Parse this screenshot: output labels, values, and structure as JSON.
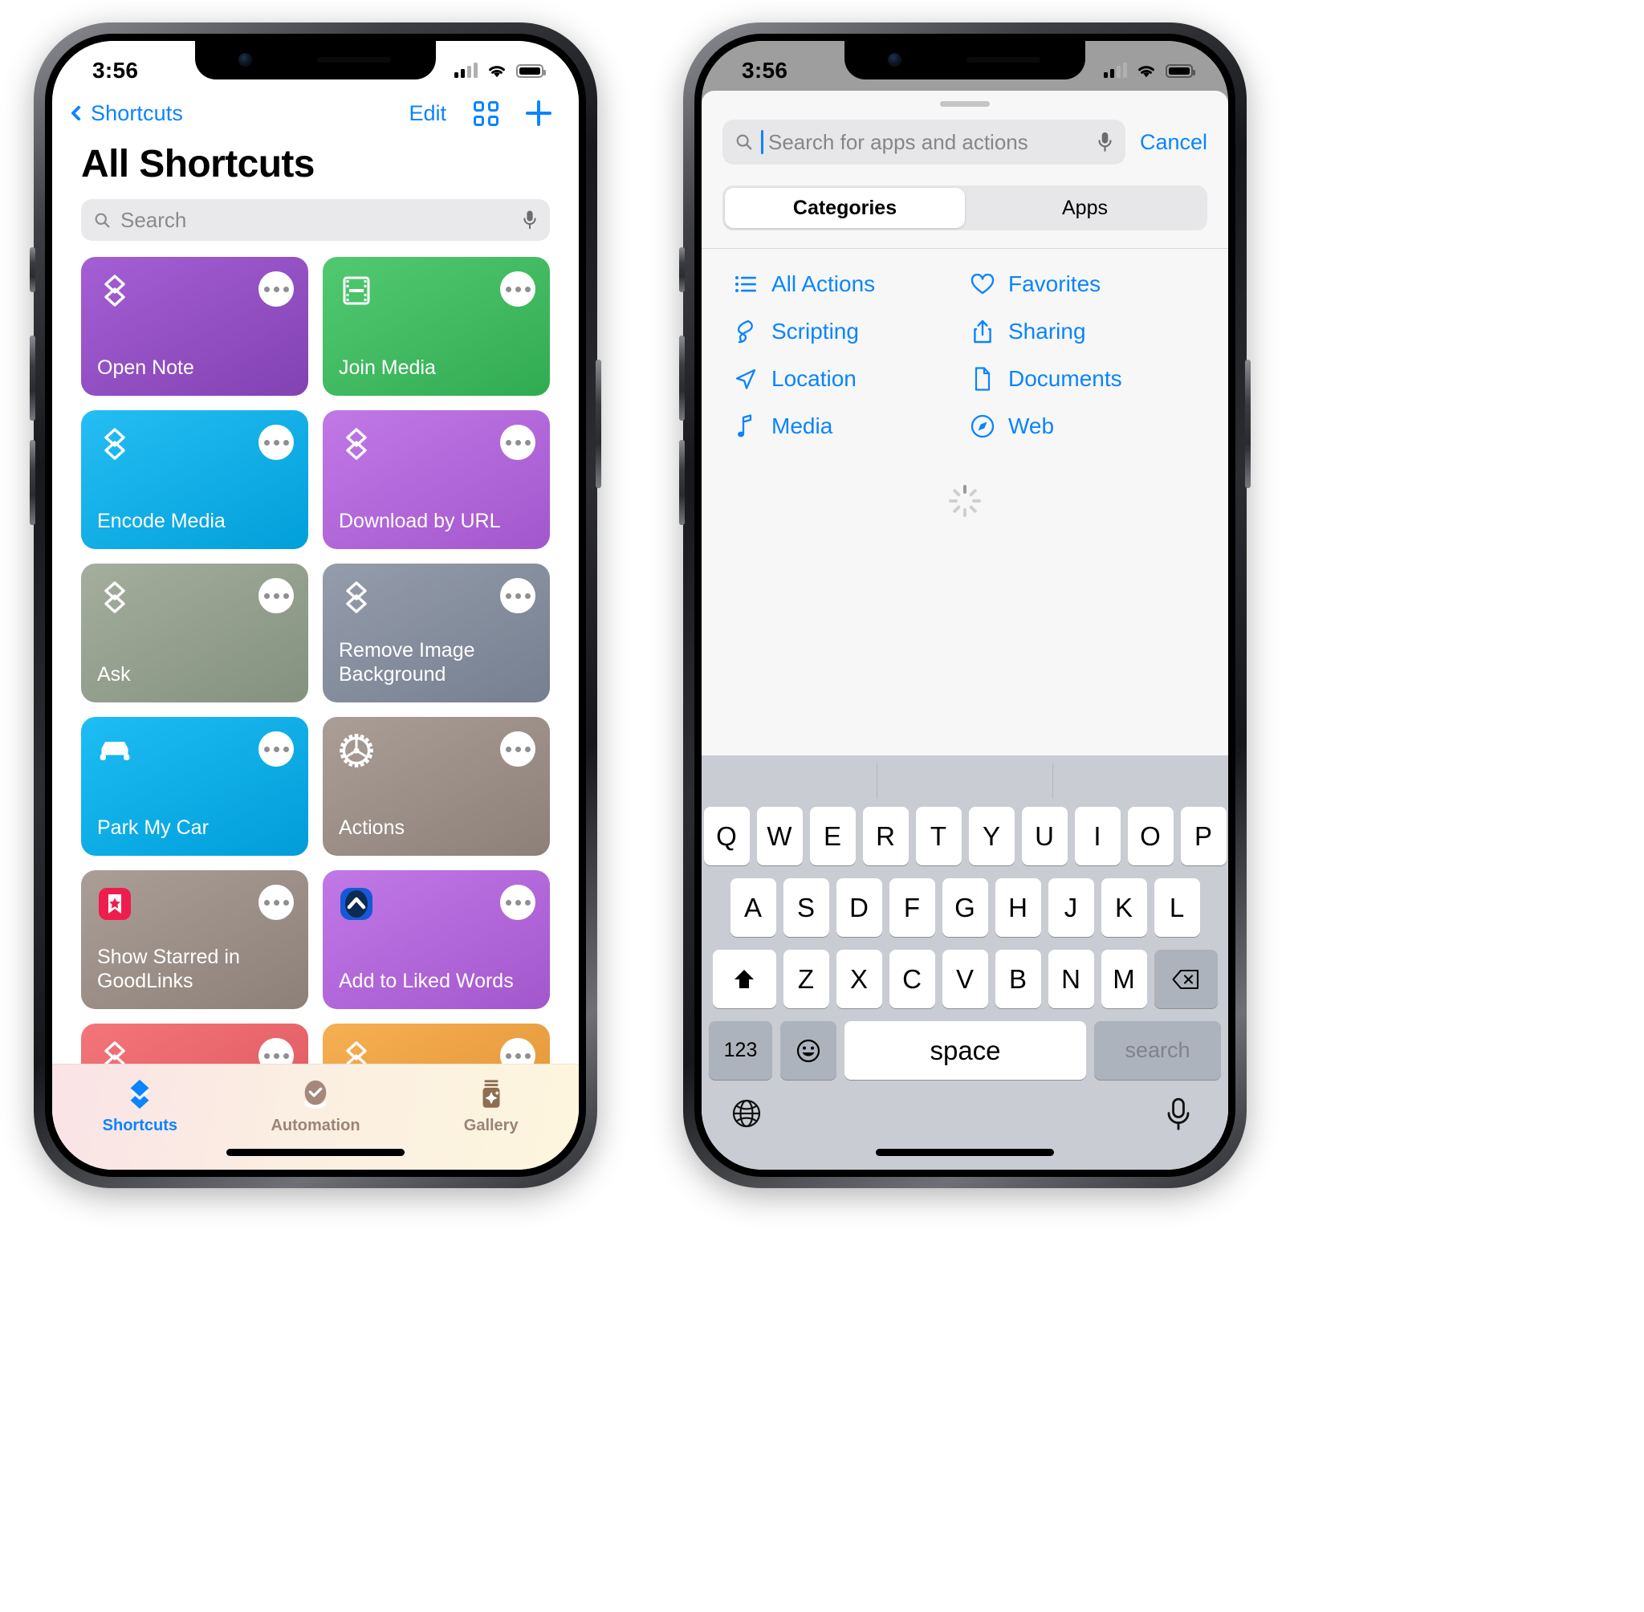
{
  "left_phone": {
    "status_bar": {
      "time": "3:56",
      "signal_icon": "cellular-bars-icon",
      "wifi_icon": "wifi-icon",
      "battery_icon": "battery-icon"
    },
    "nav": {
      "back_label": "Shortcuts",
      "back_icon": "chevron-left-icon",
      "edit_label": "Edit",
      "grid_icon": "grid-view-icon",
      "add_icon": "plus-icon"
    },
    "page_title": "All Shortcuts",
    "search": {
      "placeholder": "Search",
      "search_icon": "magnifier-icon",
      "mic_icon": "microphone-icon"
    },
    "shortcuts": [
      {
        "name": "Open Note",
        "color": "#9b4fd0",
        "color2": "#8a46bd",
        "icon": "shortcuts-layers-icon"
      },
      {
        "name": "Join Media",
        "color": "#41c463",
        "color2": "#34b656",
        "icon": "film-strip-icon"
      },
      {
        "name": "Encode Media",
        "color": "#0fb7f2",
        "color2": "#01a9e8",
        "icon": "shortcuts-layers-icon"
      },
      {
        "name": "Download by URL",
        "color": "#bb6be4",
        "color2": "#ad5cd9",
        "icon": "shortcuts-layers-icon"
      },
      {
        "name": "Ask",
        "color": "#9aa693",
        "color2": "#8d9a87",
        "icon": "shortcuts-layers-icon"
      },
      {
        "name": "Remove Image Background",
        "color": "#8a93a3",
        "color2": "#7d8798",
        "icon": "shortcuts-layers-icon"
      },
      {
        "name": "Park My Car",
        "color": "#08b6f3",
        "color2": "#00a7e6",
        "icon": "car-icon"
      },
      {
        "name": "Actions",
        "color": "#a2948c",
        "color2": "#968880",
        "icon": "gear-icon"
      },
      {
        "name": "Show Starred in GoodLinks",
        "color": "#a2948c",
        "color2": "#968880",
        "icon": "goodlinks-app-icon"
      },
      {
        "name": "Add to Liked Words",
        "color": "#bb6be4",
        "color2": "#ad5cd9",
        "icon": "chevron-up-app-icon"
      },
      {
        "name": "",
        "color": "#f2676c",
        "color2": "#e85a60",
        "icon": "shortcuts-layers-icon"
      },
      {
        "name": "",
        "color": "#f5a742",
        "color2": "#ec9a33",
        "icon": "shortcuts-layers-icon"
      }
    ],
    "tabs": [
      {
        "label": "Shortcuts",
        "icon": "shortcuts-layers-icon",
        "active": true
      },
      {
        "label": "Automation",
        "icon": "automation-clock-icon",
        "active": false
      },
      {
        "label": "Gallery",
        "icon": "gallery-jar-icon",
        "active": false
      }
    ]
  },
  "right_phone": {
    "status_bar": {
      "time": "3:56",
      "signal_icon": "cellular-bars-icon",
      "wifi_icon": "wifi-icon",
      "battery_icon": "battery-icon"
    },
    "search": {
      "placeholder": "Search for apps and actions",
      "search_icon": "magnifier-icon",
      "mic_icon": "microphone-icon",
      "cancel_label": "Cancel"
    },
    "segments": [
      {
        "label": "Categories",
        "selected": true
      },
      {
        "label": "Apps",
        "selected": false
      }
    ],
    "categories": [
      {
        "label": "All Actions",
        "icon": "list-bullets-icon"
      },
      {
        "label": "Favorites",
        "icon": "heart-icon"
      },
      {
        "label": "Scripting",
        "icon": "scripting-ribbon-icon"
      },
      {
        "label": "Sharing",
        "icon": "share-up-arrow-icon"
      },
      {
        "label": "Location",
        "icon": "location-arrow-icon"
      },
      {
        "label": "Documents",
        "icon": "document-page-icon"
      },
      {
        "label": "Media",
        "icon": "music-note-icon"
      },
      {
        "label": "Web",
        "icon": "safari-compass-icon"
      }
    ],
    "loading_indicator": "activity-spinner-icon",
    "keyboard": {
      "row1": [
        "Q",
        "W",
        "E",
        "R",
        "T",
        "Y",
        "U",
        "I",
        "O",
        "P"
      ],
      "row2": [
        "A",
        "S",
        "D",
        "F",
        "G",
        "H",
        "J",
        "K",
        "L"
      ],
      "row3": [
        "Z",
        "X",
        "C",
        "V",
        "B",
        "N",
        "M"
      ],
      "shift_icon": "shift-arrow-icon",
      "backspace_icon": "backspace-delete-icon",
      "numeric_label": "123",
      "emoji_icon": "emoji-smiley-icon",
      "space_label": "space",
      "return_label": "search",
      "globe_icon": "globe-language-icon",
      "dictation_icon": "microphone-icon"
    }
  },
  "colors": {
    "accent_blue": "#0a84ff",
    "keyboard_bg": "#c9ccd2",
    "key_dark": "#adb3bd"
  }
}
